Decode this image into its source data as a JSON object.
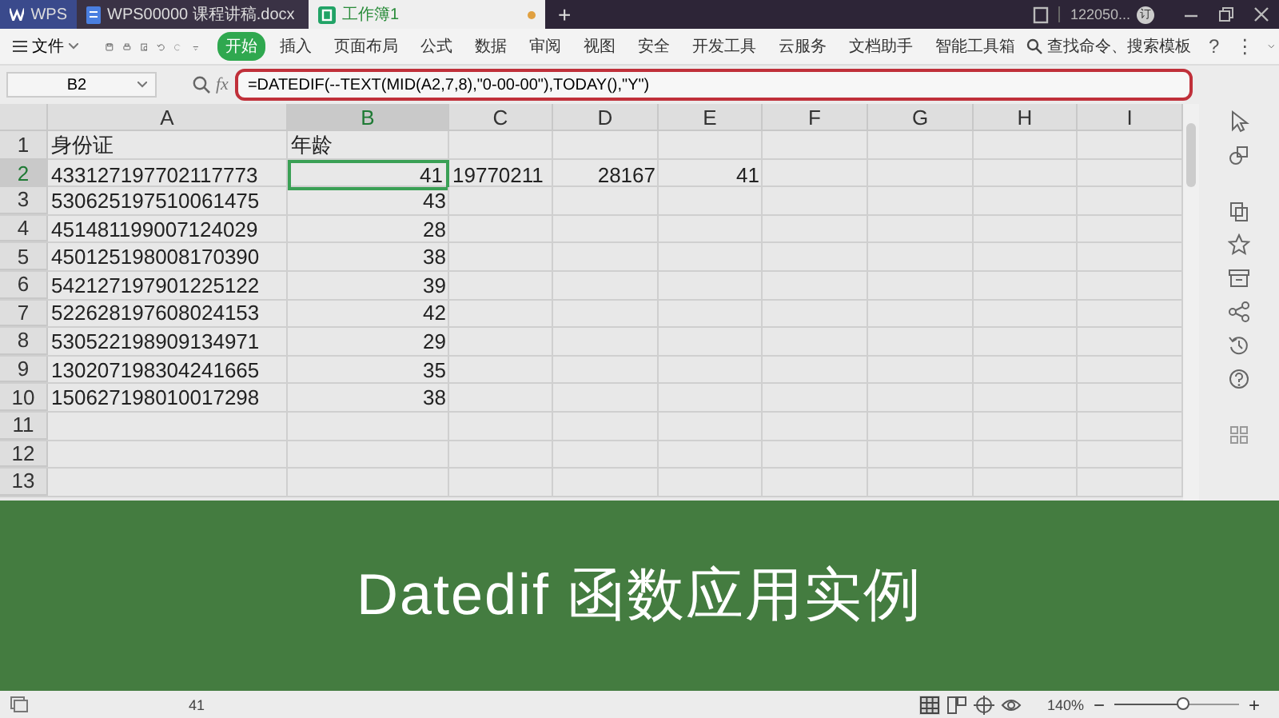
{
  "title_bar": {
    "tabs": [
      {
        "kind": "app",
        "label": "WPS",
        "selected": false
      },
      {
        "kind": "doc",
        "label": "WPS00000 课程讲稿.docx",
        "selected": false
      },
      {
        "kind": "sheet",
        "label": "工作簿1",
        "selected": true,
        "unsaved": true
      }
    ],
    "new_tab": "+",
    "user": "122050...",
    "badge": "订"
  },
  "menu": {
    "file": "文件",
    "items": [
      {
        "label": "开始",
        "selected": true
      },
      {
        "label": "插入",
        "selected": false
      },
      {
        "label": "页面布局",
        "selected": false
      },
      {
        "label": "公式",
        "selected": false
      },
      {
        "label": "数据",
        "selected": false
      },
      {
        "label": "审阅",
        "selected": false
      },
      {
        "label": "视图",
        "selected": false
      },
      {
        "label": "安全",
        "selected": false
      },
      {
        "label": "开发工具",
        "selected": false
      },
      {
        "label": "云服务",
        "selected": false
      },
      {
        "label": "文档助手",
        "selected": false
      },
      {
        "label": "智能工具箱",
        "selected": false
      }
    ],
    "search": "查找命令、搜索模板",
    "help": "?",
    "more": "⋮"
  },
  "formula_bar": {
    "name_box": "B2",
    "fx": "fx",
    "formula": "=DATEDIF(--TEXT(MID(A2,7,8),\"0-00-00\"),TODAY(),\"Y\")",
    "highlighted": true
  },
  "sheet": {
    "columns": [
      {
        "label": "A",
        "selected": false
      },
      {
        "label": "B",
        "selected": true
      },
      {
        "label": "C",
        "selected": false
      },
      {
        "label": "D",
        "selected": false
      },
      {
        "label": "E",
        "selected": false
      },
      {
        "label": "F",
        "selected": false
      },
      {
        "label": "G",
        "selected": false
      },
      {
        "label": "H",
        "selected": false
      },
      {
        "label": "I",
        "selected": false
      }
    ],
    "rows": [
      {
        "header": "1",
        "selected": false,
        "cells": [
          {
            "text": "身份证",
            "kind": "text"
          },
          {
            "text": "年龄",
            "kind": "text"
          }
        ]
      },
      {
        "header": "2",
        "selected": true,
        "cells": [
          {
            "text": "433127197702117773",
            "kind": "text"
          },
          {
            "text": "41",
            "kind": "number"
          },
          {
            "text": "19770211",
            "kind": "text"
          },
          {
            "text": "28167",
            "kind": "number"
          },
          {
            "text": "41",
            "kind": "number"
          }
        ]
      },
      {
        "header": "3",
        "selected": false,
        "cells": [
          {
            "text": "530625197510061475",
            "kind": "text"
          },
          {
            "text": "43",
            "kind": "number"
          }
        ]
      },
      {
        "header": "4",
        "selected": false,
        "cells": [
          {
            "text": "451481199007124029",
            "kind": "text"
          },
          {
            "text": "28",
            "kind": "number"
          }
        ]
      },
      {
        "header": "5",
        "selected": false,
        "cells": [
          {
            "text": "450125198008170390",
            "kind": "text"
          },
          {
            "text": "38",
            "kind": "number"
          }
        ]
      },
      {
        "header": "6",
        "selected": false,
        "cells": [
          {
            "text": "542127197901225122",
            "kind": "text"
          },
          {
            "text": "39",
            "kind": "number"
          }
        ]
      },
      {
        "header": "7",
        "selected": false,
        "cells": [
          {
            "text": "522628197608024153",
            "kind": "text"
          },
          {
            "text": "42",
            "kind": "number"
          }
        ]
      },
      {
        "header": "8",
        "selected": false,
        "cells": [
          {
            "text": "530522198909134971",
            "kind": "text"
          },
          {
            "text": "29",
            "kind": "number"
          }
        ]
      },
      {
        "header": "9",
        "selected": false,
        "cells": [
          {
            "text": "130207198304241665",
            "kind": "text"
          },
          {
            "text": "35",
            "kind": "number"
          }
        ]
      },
      {
        "header": "10",
        "selected": false,
        "cells": [
          {
            "text": "150627198010017298",
            "kind": "text"
          },
          {
            "text": "38",
            "kind": "number"
          }
        ]
      },
      {
        "header": "11",
        "selected": false,
        "cells": []
      },
      {
        "header": "12",
        "selected": false,
        "cells": []
      },
      {
        "header": "13",
        "selected": false,
        "cells": []
      }
    ]
  },
  "caption": "Datedif 函数应用实例",
  "status_bar": {
    "value": "41",
    "zoom": "140%",
    "zoom_out": "−",
    "zoom_in": "+",
    "level": 0.55
  }
}
